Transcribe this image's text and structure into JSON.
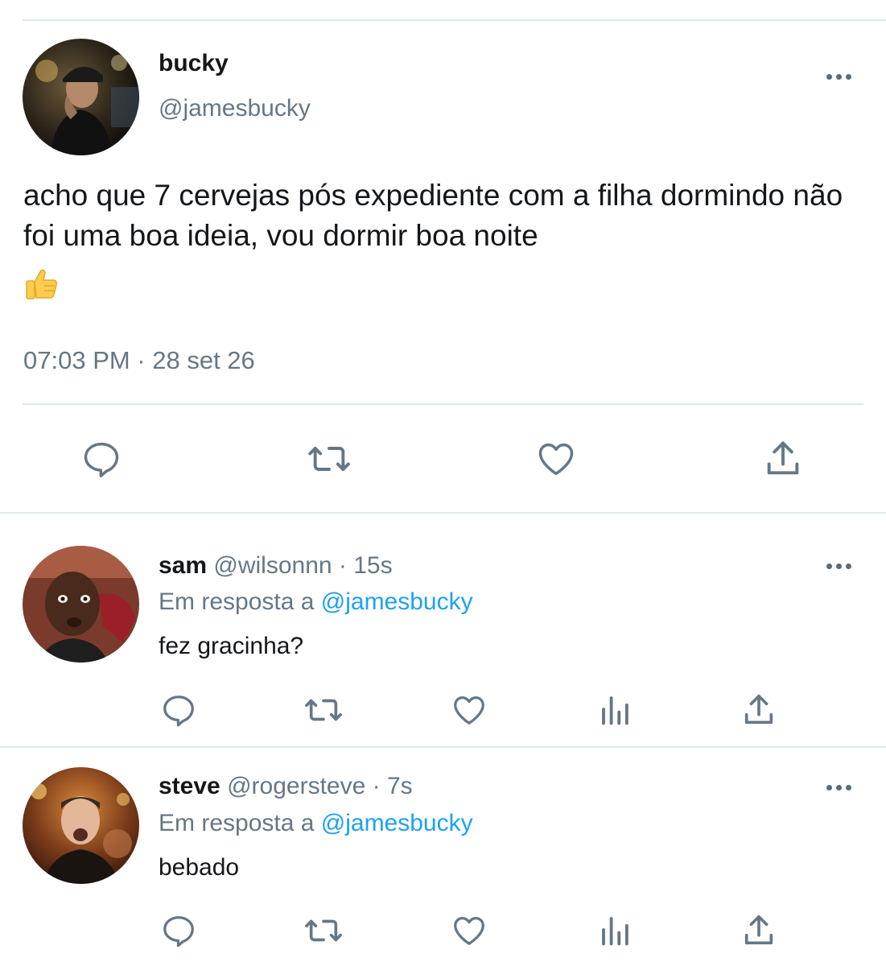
{
  "tweet": {
    "name": "bucky",
    "handle": "@jamesbucky",
    "text": "acho que 7 cervejas pós expediente com a filha dormindo não foi uma boa ideia, vou dormir boa noite",
    "emoji": "thumbs-up",
    "timestamp": "07:03 PM · 28 set 26"
  },
  "replies": [
    {
      "name": "sam",
      "handle": "@wilsonnn",
      "time": "· 15s",
      "in_reply_prefix": "Em resposta a",
      "in_reply_mention": "@jamesbucky",
      "text": "fez gracinha?"
    },
    {
      "name": "steve",
      "handle": "@rogersteve",
      "time": "· 7s",
      "in_reply_prefix": "Em resposta a",
      "in_reply_mention": "@jamesbucky",
      "text": "bebado"
    }
  ],
  "icons": {
    "reply": "speech-bubble-icon",
    "retweet": "retweet-icon",
    "like": "heart-icon",
    "analytics": "bar-chart-icon",
    "share": "share-upload-icon",
    "more": "more-dots-icon"
  },
  "colors": {
    "text": "#14171a",
    "secondary": "#657786",
    "link": "#1da1f2",
    "divider": "#e1e8ed",
    "icon": "#657786"
  }
}
